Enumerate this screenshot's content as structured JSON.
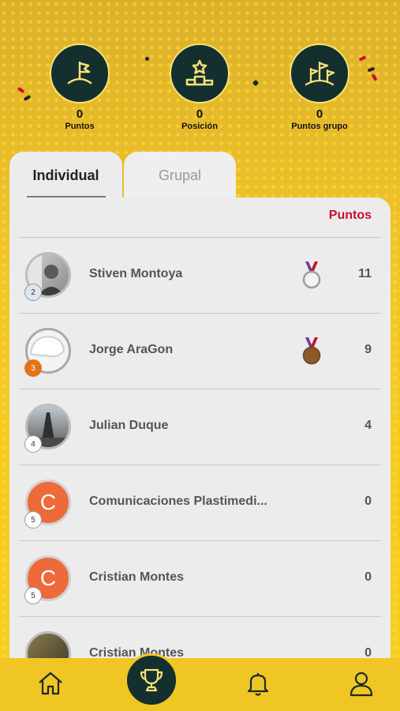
{
  "stats": [
    {
      "value": "0",
      "label": "Puntos",
      "icon": "flag-hill-icon"
    },
    {
      "value": "0",
      "label": "Posición",
      "icon": "podium-star-icon"
    },
    {
      "value": "0",
      "label": "Puntos grupo",
      "icon": "group-flags-icon"
    }
  ],
  "tabs": {
    "individual": "Individual",
    "grupal": "Grupal"
  },
  "list_header": "Puntos",
  "ranking": [
    {
      "rank": "2",
      "name": "Stiven Montoya",
      "points": "11",
      "medal": "silver",
      "avatar": "photo"
    },
    {
      "rank": "3",
      "name": "Jorge AraGon",
      "points": "9",
      "medal": "bronze",
      "avatar": "placeholder"
    },
    {
      "rank": "4",
      "name": "Julian Duque",
      "points": "4",
      "medal": "",
      "avatar": "photo"
    },
    {
      "rank": "5",
      "name": "Comunicaciones Plastimedi...",
      "points": "0",
      "medal": "",
      "avatar": "initial",
      "initial": "C"
    },
    {
      "rank": "5",
      "name": "Cristian Montes",
      "points": "0",
      "medal": "",
      "avatar": "initial",
      "initial": "C"
    },
    {
      "rank": "",
      "name": "Cristian Montes",
      "points": "0",
      "medal": "",
      "avatar": "photo"
    }
  ],
  "nav": [
    "home-icon",
    "trophy-icon",
    "bell-icon",
    "user-icon"
  ],
  "colors": {
    "accent": "#c8102e",
    "dark": "#14302e",
    "yellow": "#f0c624"
  }
}
